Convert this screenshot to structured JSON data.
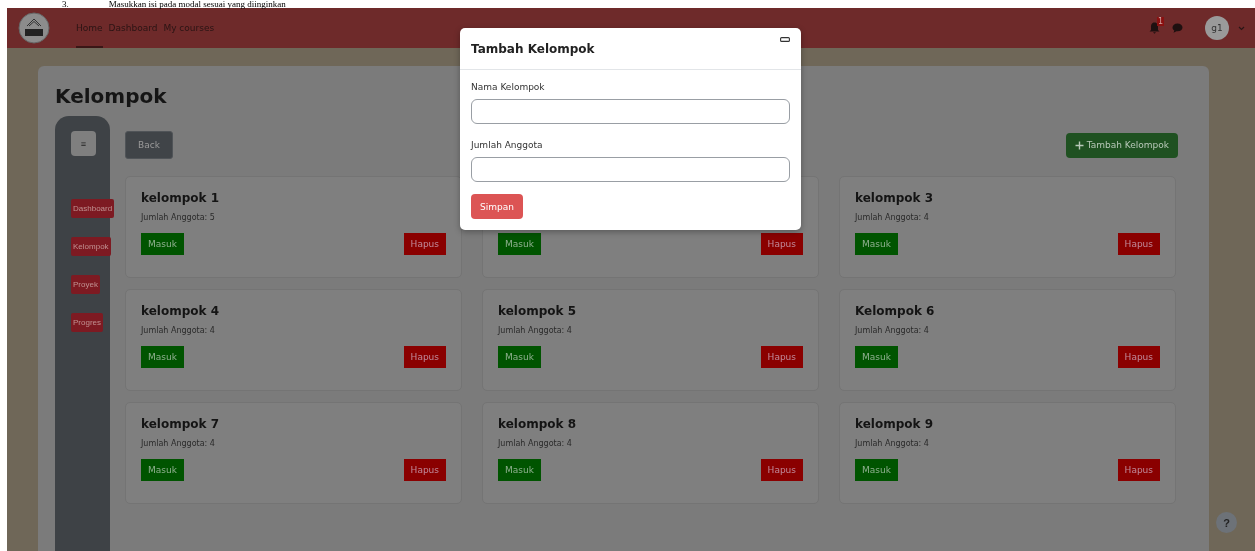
{
  "doc_caption": {
    "number": "3.",
    "text": "Masukkan isi pada modal sesuai yang diinginkan"
  },
  "navbar": {
    "links": [
      {
        "label": "Home",
        "selected": true
      },
      {
        "label": "Dashboard",
        "selected": false
      },
      {
        "label": "My courses",
        "selected": false
      }
    ],
    "notification_count": "1",
    "avatar_initials": "g1"
  },
  "page": {
    "title": "Kelompok",
    "back_button": "Back",
    "add_button": "Tambah Kelompok",
    "sidebar": {
      "toggle": "≡",
      "items": [
        "Dashboard",
        "Kelompok",
        "Proyek",
        "Progres"
      ]
    },
    "first_group": {
      "name": "kelompok 1",
      "members": "Jumlah Anggota: 5",
      "enter_button": "Masuk",
      "delete_button": "Hapus"
    },
    "group_under_modal": {
      "enter_button": "Masuk",
      "delete_button": "Hapus"
    },
    "groups": [
      {
        "name": "kelompok 3",
        "members": "Jumlah Anggota: 4",
        "enter_button": "Masuk",
        "delete_button": "Hapus"
      },
      {
        "name": "kelompok 4",
        "members": "Jumlah Anggota: 4",
        "enter_button": "Masuk",
        "delete_button": "Hapus"
      },
      {
        "name": "kelompok 5",
        "members": "Jumlah Anggota: 4",
        "enter_button": "Masuk",
        "delete_button": "Hapus"
      },
      {
        "name": "Kelompok 6",
        "members": "Jumlah Anggota: 4",
        "enter_button": "Masuk",
        "delete_button": "Hapus"
      },
      {
        "name": "kelompok 7",
        "members": "Jumlah Anggota: 4",
        "enter_button": "Masuk",
        "delete_button": "Hapus"
      },
      {
        "name": "kelompok 8",
        "members": "Jumlah Anggota: 4",
        "enter_button": "Masuk",
        "delete_button": "Hapus"
      },
      {
        "name": "kelompok 9",
        "members": "Jumlah Anggota: 4",
        "enter_button": "Masuk",
        "delete_button": "Hapus"
      }
    ]
  },
  "modal": {
    "title": "Tambah Kelompok",
    "fields": [
      {
        "label": "Nama Kelompok"
      },
      {
        "label": "Jumlah Anggota"
      }
    ],
    "submit_button": "Simpan"
  },
  "help_button": "?"
}
